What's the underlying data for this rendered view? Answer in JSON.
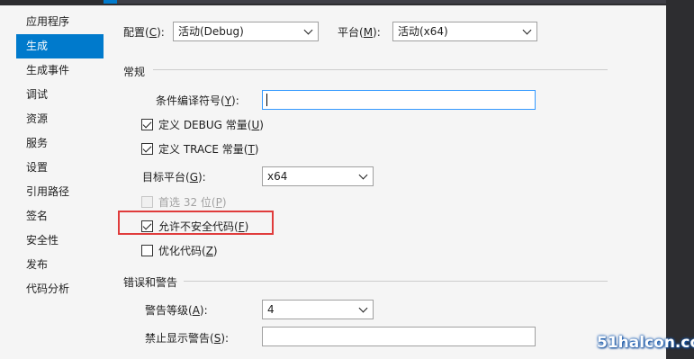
{
  "sidebar": {
    "items": [
      {
        "label": "应用程序",
        "active": false
      },
      {
        "label": "生成",
        "active": true
      },
      {
        "label": "生成事件",
        "active": false
      },
      {
        "label": "调试",
        "active": false
      },
      {
        "label": "资源",
        "active": false
      },
      {
        "label": "服务",
        "active": false
      },
      {
        "label": "设置",
        "active": false
      },
      {
        "label": "引用路径",
        "active": false
      },
      {
        "label": "签名",
        "active": false
      },
      {
        "label": "安全性",
        "active": false
      },
      {
        "label": "发布",
        "active": false
      },
      {
        "label": "代码分析",
        "active": false
      }
    ]
  },
  "toolbar": {
    "config_label_pre": "配置(",
    "config_label_key": "C",
    "config_label_post": "):",
    "config_value": "活动(Debug)",
    "platform_label_pre": "平台(",
    "platform_label_key": "M",
    "platform_label_post": "):",
    "platform_value": "活动(x64)"
  },
  "general": {
    "title": "常规",
    "symbols_label_pre": "条件编译符号(",
    "symbols_label_key": "Y",
    "symbols_label_post": "):",
    "symbols_value": "",
    "define_debug": {
      "pre": "定义 DEBUG 常量(",
      "key": "U",
      "post": ")",
      "checked": true
    },
    "define_trace": {
      "pre": "定义 TRACE 常量(",
      "key": "T",
      "post": ")",
      "checked": true
    },
    "target_label_pre": "目标平台(",
    "target_label_key": "G",
    "target_label_post": "):",
    "target_value": "x64",
    "prefer32": {
      "pre": "首选 32 位(",
      "key": "P",
      "post": ")",
      "checked": false,
      "disabled": true
    },
    "unsafe": {
      "pre": "允许不安全代码(",
      "key": "F",
      "post": ")",
      "checked": true
    },
    "optimize": {
      "pre": "优化代码(",
      "key": "Z",
      "post": ")",
      "checked": false
    }
  },
  "errors": {
    "title": "错误和警告",
    "warning_level_pre": "警告等级(",
    "warning_level_key": "A",
    "warning_level_post": "):",
    "warning_level_value": "4",
    "suppress_pre": "禁止显示警告(",
    "suppress_key": "S",
    "suppress_post": "):",
    "suppress_value": ""
  },
  "watermark": "51halcon.com",
  "colors": {
    "accent": "#007acc",
    "highlight_border": "#e03c3c"
  }
}
